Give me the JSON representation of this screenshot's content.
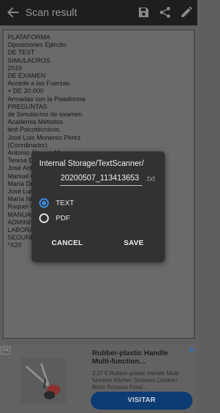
{
  "appbar": {
    "title": "Scan result",
    "back_icon": "arrow-left-icon",
    "actions": [
      "save-icon",
      "share-icon",
      "edit-icon"
    ]
  },
  "document": {
    "lines": [
      "PLATAFORMA",
      "Oposiciones Ejército",
      "DE TEST",
      "SIMULACROS",
      "2019",
      "DE EXAMEN",
      "Accede a las Fuerzas",
      "+ DE 20.000",
      "Armadas con la Plataforma",
      "PREGUNTAS",
      "de Simulacros de examen",
      "Academia Métodos",
      "test Psicotécnicos.",
      "José Luis Monereo Pérez",
      "(Coordinador)",
      "Antonio Álvarez Montero",
      "Teresa Díaz",
      "José Antonio Fernández Avilés",
      "Manuel García",
      "María Dolores García Valverde",
      "José Luis Monereo Pérez",
      "María Nieves Moreno Vida",
      "Raquel Vida Fernández",
      "MANUAL DE DERECHO",
      "ADMINISTRATIVO",
      "LABORAL",
      "SEGUNDA EDICIÓN",
      "*X20"
    ]
  },
  "dialog": {
    "path": "Internal Storage/TextScanner/",
    "filename": "20200507_113413653",
    "extension": ".txt",
    "options": [
      {
        "label": "TEXT",
        "selected": true
      },
      {
        "label": "PDF",
        "selected": false
      }
    ],
    "cancel_label": "CANCEL",
    "save_label": "SAVE",
    "accent_color": "#3b8fe8"
  },
  "ad": {
    "adchoices_label": "Ad",
    "headline": "Rubber-plastic Handle Multi-function...",
    "body": "2,37 € Rubber-plastic Handle Multi-function Kitchen Scissors Chicken Bone Scissors Food...",
    "cta_label": "VISITAR",
    "image_icon": "scissors-product-image"
  }
}
